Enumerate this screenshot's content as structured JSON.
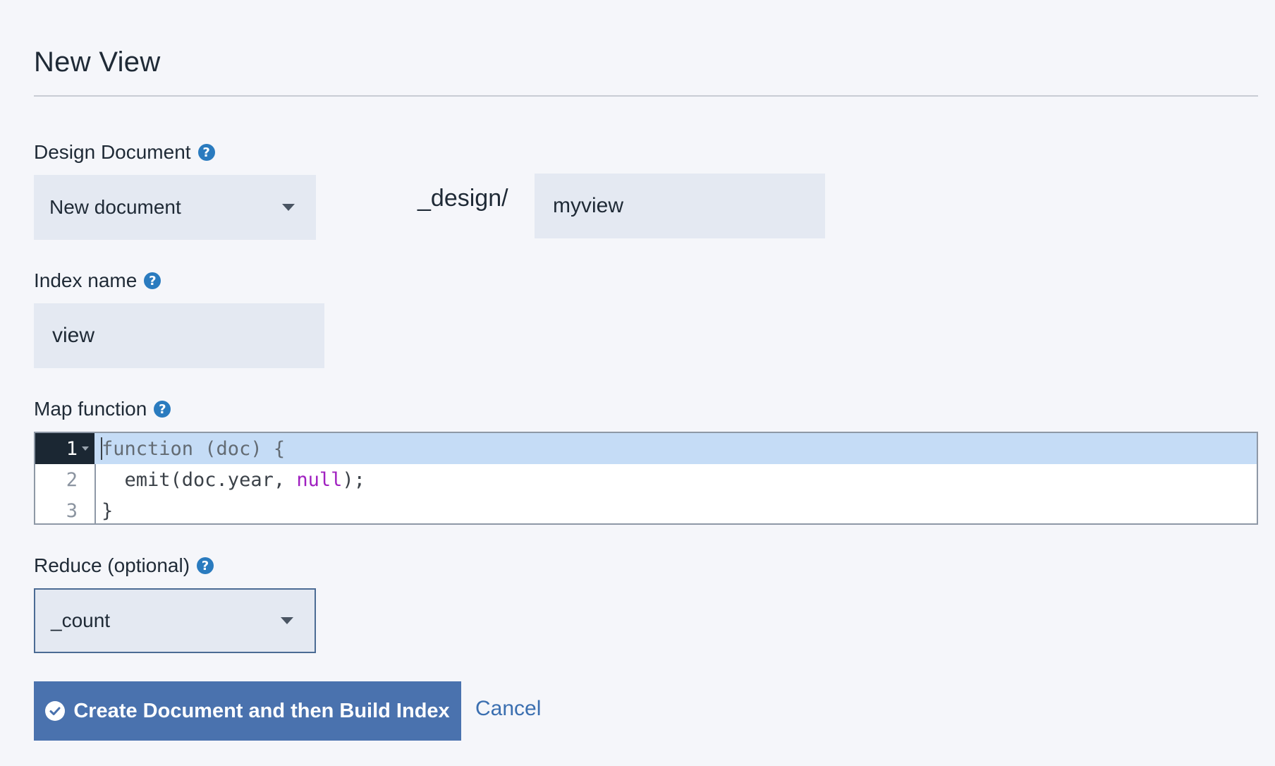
{
  "page": {
    "title": "New View"
  },
  "design_document": {
    "label": "Design Document",
    "help": "?",
    "selected": "New document",
    "prefix": "_design/",
    "name_value": "myview"
  },
  "index_name": {
    "label": "Index name",
    "help": "?",
    "value": "view"
  },
  "map_function": {
    "label": "Map function",
    "help": "?",
    "line_numbers": [
      "1",
      "2",
      "3"
    ],
    "lines": {
      "l1": "function (doc) {",
      "l2_a": "  emit(doc.year, ",
      "l2_null": "null",
      "l2_b": ");",
      "l3": "}"
    }
  },
  "reduce": {
    "label": "Reduce (optional)",
    "help": "?",
    "selected": "_count"
  },
  "actions": {
    "create_label": "Create Document and then Build Index",
    "cancel_label": "Cancel"
  },
  "colors": {
    "primary_button": "#4a72ae",
    "link": "#3b6fb0",
    "help_icon": "#2a7bbf",
    "input_bg": "#e4e9f2",
    "active_line": "#c5dcf6"
  },
  "icons": {
    "help": "question-circle-icon",
    "dropdown": "caret-down-icon",
    "button": "check-circle-icon"
  }
}
